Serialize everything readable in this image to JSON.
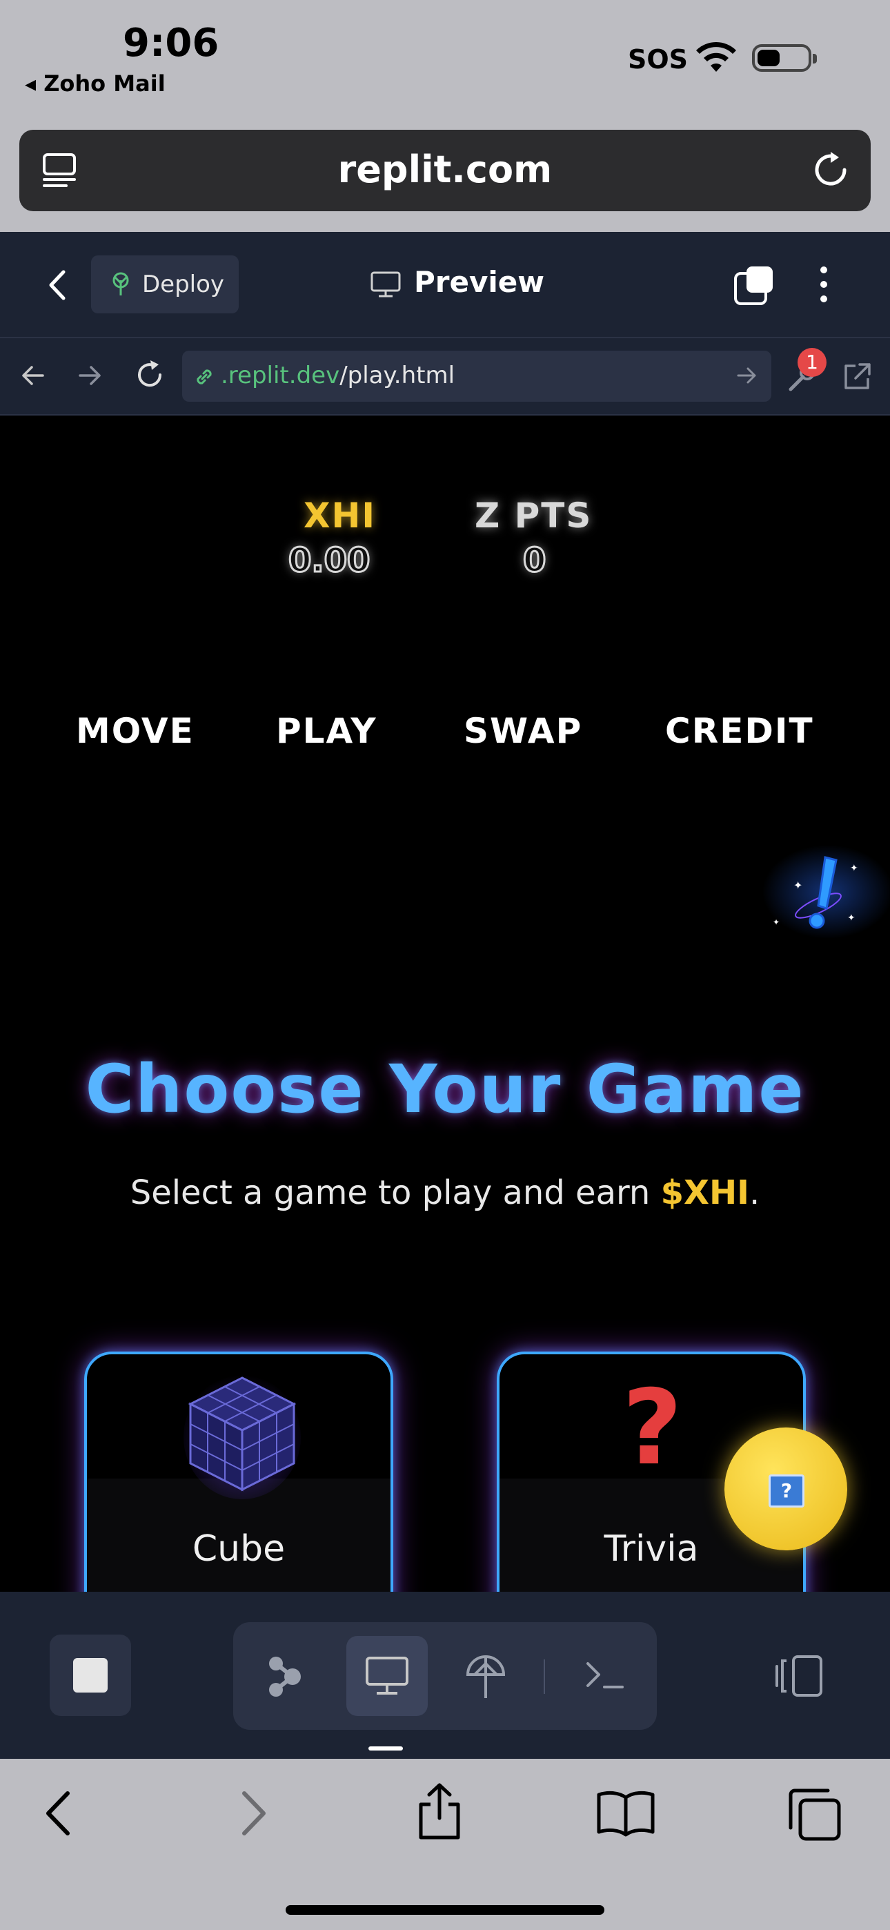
{
  "status_bar": {
    "time": "9:06",
    "back_app": "◂ Zoho Mail",
    "carrier": "SOS",
    "battery_level": 0.45
  },
  "safari": {
    "host": "replit.com",
    "icons": [
      "tabs-overview-icon",
      "reload-icon",
      "back-icon",
      "forward-icon",
      "share-icon",
      "bookmarks-icon",
      "tabs-icon"
    ]
  },
  "replit_header": {
    "deploy_label": "Deploy",
    "preview_label": "Preview"
  },
  "preview_nav": {
    "domain": ".replit.dev",
    "path": "/play.html",
    "devtools_badge": "1"
  },
  "game": {
    "stats": {
      "xhi_label": "XHI",
      "xhi_value": "0.00",
      "pts_label": "Z PTS",
      "pts_value": "0"
    },
    "menu": [
      "MOVE",
      "PLAY",
      "SWAP",
      "CREDIT"
    ],
    "title": "Choose Your Game",
    "subtitle_prefix": "Select a game to play and earn ",
    "subtitle_currency": "$XHI",
    "subtitle_suffix": ".",
    "cards": [
      {
        "title": "Cube"
      },
      {
        "title": "Trivia"
      }
    ],
    "help_fab_glyph": "?"
  },
  "colors": {
    "accent_blue": "#57b4ff",
    "gold": "#f4c531",
    "replit_bg": "#1c2333",
    "url_green": "#58c27d"
  }
}
